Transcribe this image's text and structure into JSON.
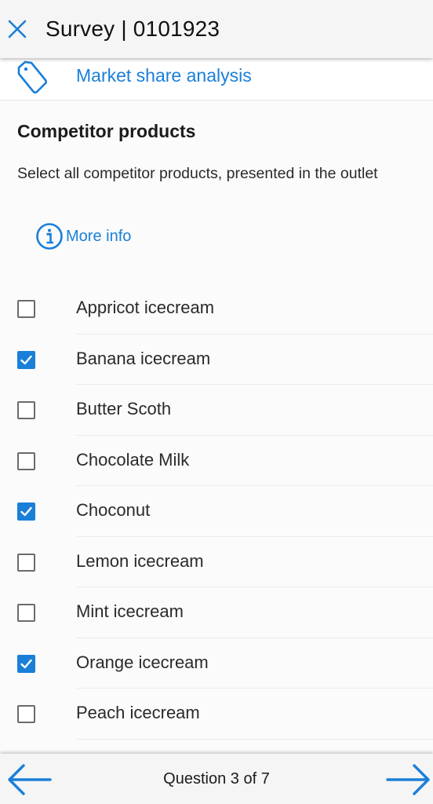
{
  "header": {
    "title": "Survey | 0101923",
    "close_icon": "close-icon"
  },
  "category": {
    "icon": "tag-icon",
    "label": "Market share analysis"
  },
  "question": {
    "title": "Competitor products",
    "description": "Select all competitor products, presented in the outlet",
    "more_info_label": "More info",
    "more_info_icon": "info-icon"
  },
  "options": [
    {
      "label": "Appricot icecream",
      "checked": false
    },
    {
      "label": "Banana icecream",
      "checked": true
    },
    {
      "label": "Butter Scoth",
      "checked": false
    },
    {
      "label": "Chocolate Milk",
      "checked": false
    },
    {
      "label": "Choconut",
      "checked": true
    },
    {
      "label": "Lemon icecream",
      "checked": false
    },
    {
      "label": "Mint icecream",
      "checked": false
    },
    {
      "label": "Orange icecream",
      "checked": true
    },
    {
      "label": "Peach icecream",
      "checked": false
    }
  ],
  "footer": {
    "progress_text": "Question 3 of 7",
    "current_question": 3,
    "total_questions": 7,
    "prev_icon": "arrow-left-icon",
    "next_icon": "arrow-right-icon"
  },
  "colors": {
    "accent": "#1a7fd9",
    "checkbox_border": "#6b6b6b"
  }
}
